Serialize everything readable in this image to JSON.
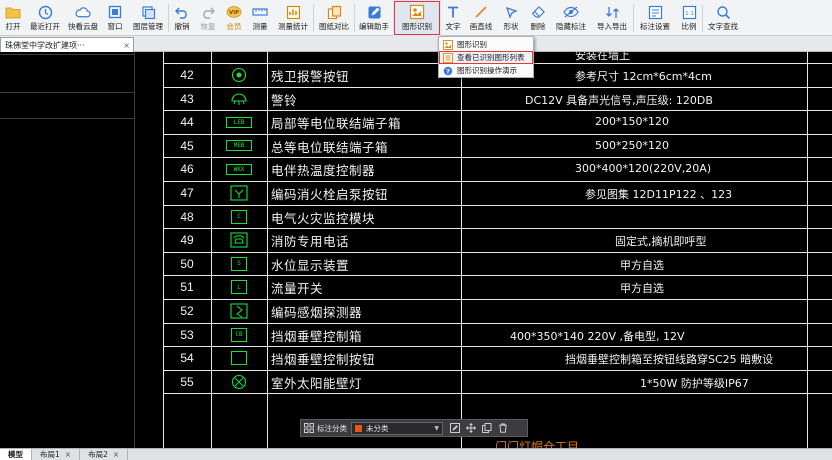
{
  "toolbar": {
    "buttons": [
      {
        "id": "open",
        "label": "打开",
        "icon": "folder-icon"
      },
      {
        "id": "recent",
        "label": "最近打开",
        "icon": "clock-icon"
      },
      {
        "id": "cloud",
        "label": "快看云盘",
        "icon": "cloud-icon"
      },
      {
        "id": "window",
        "label": "窗口",
        "icon": "window-icon"
      },
      {
        "id": "layers",
        "label": "图层管理",
        "icon": "layers-icon"
      },
      {
        "id": "undo",
        "label": "撤销",
        "icon": "undo-icon"
      },
      {
        "id": "redo",
        "label": "恢复",
        "icon": "redo-icon"
      },
      {
        "id": "vip",
        "label": "会员",
        "icon": "vip-icon"
      },
      {
        "id": "measure",
        "label": "测量",
        "icon": "measure-icon"
      },
      {
        "id": "measure_stats",
        "label": "测量统计",
        "icon": "measure-stats-icon"
      },
      {
        "id": "compare",
        "label": "图纸对比",
        "icon": "compare-icon"
      },
      {
        "id": "assistant",
        "label": "编辑助手",
        "icon": "assistant-icon"
      },
      {
        "id": "recognize",
        "label": "图形识别",
        "icon": "recognize-icon"
      },
      {
        "id": "text",
        "label": "文字",
        "icon": "text-icon"
      },
      {
        "id": "line",
        "label": "画直线",
        "icon": "line-icon"
      },
      {
        "id": "shape",
        "label": "形状",
        "icon": "shape-icon"
      },
      {
        "id": "delete",
        "label": "删除",
        "icon": "eraser-icon"
      },
      {
        "id": "hide",
        "label": "隐藏标注",
        "icon": "eye-off-icon"
      },
      {
        "id": "import_export",
        "label": "导入导出",
        "icon": "import-export-icon"
      },
      {
        "id": "label_settings",
        "label": "标注设置",
        "icon": "label-settings-icon"
      },
      {
        "id": "scale",
        "label": "比例",
        "icon": "scale-icon"
      },
      {
        "id": "find_text",
        "label": "文字查找",
        "icon": "search-icon"
      }
    ]
  },
  "doc_tab": {
    "title": "珠佛堂中学改扩建项···",
    "close": "×"
  },
  "dropdown": {
    "items": [
      {
        "label": "图形识别",
        "icon": "recognize-icon"
      },
      {
        "label": "查看已识别图形列表",
        "icon": "list-icon"
      },
      {
        "label": "图形识别操作演示",
        "icon": "help-icon"
      }
    ]
  },
  "legend_rows": [
    {
      "num": "42",
      "symbol": "circle-dot",
      "name": "残卫报警按钮",
      "spec": "参考尺寸 12cm*6cm*4cm"
    },
    {
      "num": "43",
      "symbol": "bell",
      "name": "警铃",
      "spec": "DC12V    具备声光信号,声压级: 120DB"
    },
    {
      "num": "44",
      "symbol": "box",
      "symbol_text": "LEB",
      "name": "局部等电位联结端子箱",
      "spec": "200*150*120"
    },
    {
      "num": "45",
      "symbol": "box",
      "symbol_text": "MEB",
      "name": "总等电位联结端子箱",
      "spec": "500*250*120"
    },
    {
      "num": "46",
      "symbol": "box",
      "symbol_text": "WKX",
      "name": "电伴热温度控制器",
      "spec": "300*400*120(220V,20A)"
    },
    {
      "num": "47",
      "symbol": "pump",
      "name": "编码消火栓启泵按钮",
      "spec": "参见图集 12D11P122       、123"
    },
    {
      "num": "48",
      "symbol": "box",
      "symbol_text": "C",
      "name": "电气火灾监控模块",
      "spec": ""
    },
    {
      "num": "49",
      "symbol": "phone",
      "name": "消防专用电话",
      "spec": "固定式,摘机即呼型"
    },
    {
      "num": "50",
      "symbol": "box",
      "symbol_text": "S",
      "name": "水位显示装置",
      "spec": "甲方自选"
    },
    {
      "num": "51",
      "symbol": "box",
      "symbol_text": "L",
      "name": "流量开关",
      "spec": "甲方自选"
    },
    {
      "num": "52",
      "symbol": "smoke",
      "name": "编码感烟探测器",
      "spec": ""
    },
    {
      "num": "53",
      "symbol": "box",
      "symbol_text": "CB",
      "name": "挡烟垂壁控制箱",
      "spec": "400*350*140                    220V  ,备电型, 12V"
    },
    {
      "num": "54",
      "symbol": "box",
      "symbol_text": "",
      "name": "挡烟垂壁控制按钮",
      "spec": "挡烟垂壁控制箱至按钮线路穿SC25  暗敷设"
    },
    {
      "num": "55",
      "symbol": "circle-x",
      "name": "室外太阳能壁灯",
      "spec": "1*50W                   防护等级IP67"
    }
  ],
  "partial_top_text": "安装在墙上",
  "partial_bottom_text": "门门灯帽仓工目",
  "floatbar": {
    "label": "标注分类",
    "selected": "未分类",
    "swatch_color": "#e2581a"
  },
  "bottom_tabs": [
    {
      "label": "模型",
      "active": true
    },
    {
      "label": "布局1",
      "active": false
    },
    {
      "label": "布局2",
      "active": false
    }
  ],
  "colors": {
    "symbol_green": "#19e03a",
    "highlight_red": "#e53935",
    "line_white": "#e8e8e8"
  }
}
